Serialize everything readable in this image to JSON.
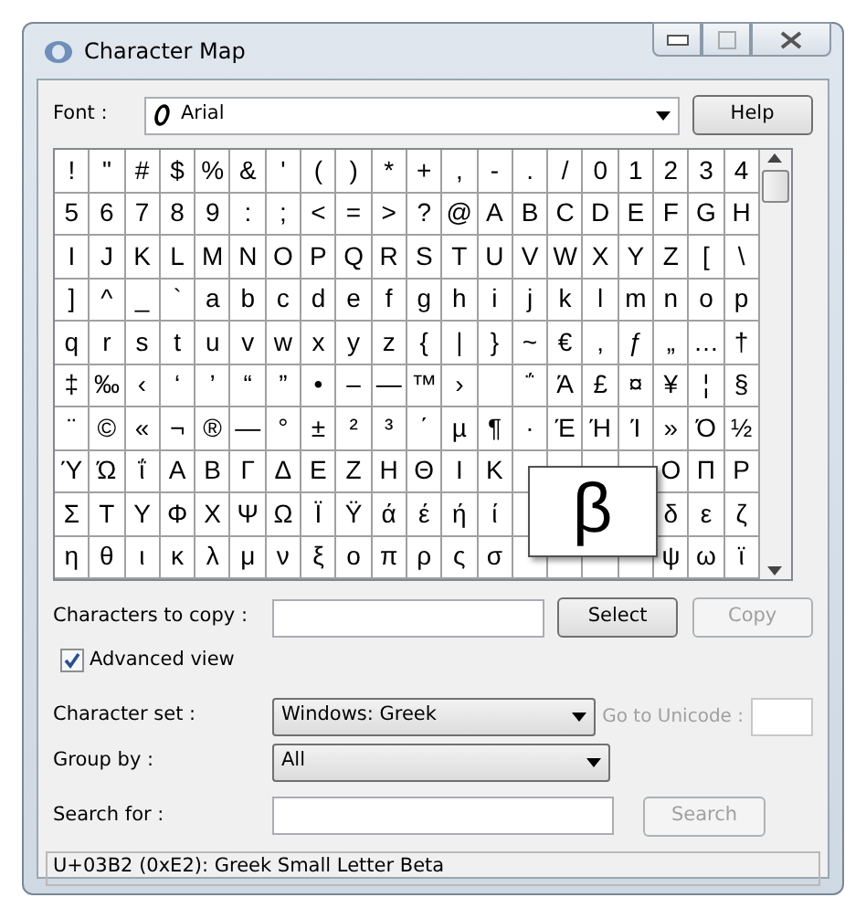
{
  "window": {
    "title": "Character Map"
  },
  "font": {
    "label": "Font :",
    "value": "Arial"
  },
  "help_button": "Help",
  "grid": {
    "rows": [
      [
        "!",
        "\"",
        "#",
        "$",
        "%",
        "&",
        "'",
        "(",
        ")",
        "*",
        "+",
        ",",
        "-",
        ".",
        "/",
        "0",
        "1",
        "2",
        "3",
        "4"
      ],
      [
        "5",
        "6",
        "7",
        "8",
        "9",
        ":",
        ";",
        "<",
        "=",
        ">",
        "?",
        "@",
        "A",
        "B",
        "C",
        "D",
        "E",
        "F",
        "G",
        "H"
      ],
      [
        "I",
        "J",
        "K",
        "L",
        "M",
        "N",
        "O",
        "P",
        "Q",
        "R",
        "S",
        "T",
        "U",
        "V",
        "W",
        "X",
        "Y",
        "Z",
        "[",
        "\\"
      ],
      [
        "]",
        "^",
        "_",
        "`",
        "a",
        "b",
        "c",
        "d",
        "e",
        "f",
        "g",
        "h",
        "i",
        "j",
        "k",
        "l",
        "m",
        "n",
        "o",
        "p"
      ],
      [
        "q",
        "r",
        "s",
        "t",
        "u",
        "v",
        "w",
        "x",
        "y",
        "z",
        "{",
        "|",
        "}",
        "~",
        "€",
        "‚",
        "ƒ",
        "„",
        "…",
        "†"
      ],
      [
        "‡",
        "‰",
        "‹",
        "‘",
        "’",
        "“",
        "”",
        "•",
        "–",
        "—",
        "™",
        "›",
        " ",
        "΅",
        "Ά",
        "£",
        "¤",
        "¥",
        "¦",
        "§"
      ],
      [
        "¨",
        "©",
        "«",
        "¬",
        "®",
        "―",
        "°",
        "±",
        "²",
        "³",
        "΄",
        "µ",
        "¶",
        "·",
        "Έ",
        "Ή",
        "Ί",
        "»",
        "Ό",
        "½"
      ],
      [
        "Ύ",
        "Ώ",
        "ΐ",
        "Α",
        "Β",
        "Γ",
        "Δ",
        "Ε",
        "Ζ",
        "Η",
        "Θ",
        "Ι",
        "Κ",
        null,
        null,
        null,
        null,
        "Ο",
        "Π",
        "Ρ"
      ],
      [
        "Σ",
        "Τ",
        "Υ",
        "Φ",
        "Χ",
        "Ψ",
        "Ω",
        "Ϊ",
        "Ϋ",
        "ά",
        "έ",
        "ή",
        "ί",
        null,
        null,
        null,
        null,
        "δ",
        "ε",
        "ζ"
      ],
      [
        "η",
        "θ",
        "ι",
        "κ",
        "λ",
        "μ",
        "ν",
        "ξ",
        "ο",
        "π",
        "ρ",
        "ς",
        "σ",
        null,
        null,
        null,
        null,
        "ψ",
        "ω",
        "ϊ"
      ]
    ],
    "magnified": "β"
  },
  "copy": {
    "label": "Characters to copy :",
    "select_button": "Select",
    "copy_button": "Copy",
    "copy_disabled": true
  },
  "advanced_view": {
    "label": "Advanced view",
    "checked": true
  },
  "character_set": {
    "label": "Character set :",
    "value": "Windows: Greek"
  },
  "goto_unicode": {
    "label": "Go to Unicode :",
    "disabled": true
  },
  "group_by": {
    "label": "Group by :",
    "value": "All"
  },
  "search": {
    "label": "Search for :",
    "button": "Search",
    "disabled": true
  },
  "status_bar": "U+03B2 (0xE2): Greek Small Letter Beta"
}
